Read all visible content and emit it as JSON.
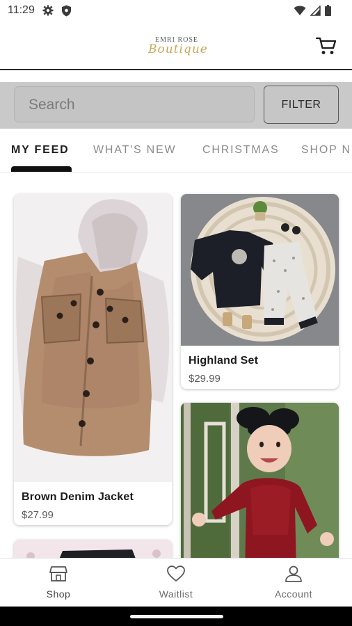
{
  "status_bar": {
    "time": "11:29",
    "icons": [
      "gear-icon",
      "shield-icon",
      "wifi-icon",
      "signal-icon",
      "battery-icon"
    ]
  },
  "header": {
    "logo_top": "EMRI ROSE",
    "logo_bottom": "Boutique",
    "cart_icon": "cart-icon"
  },
  "search": {
    "placeholder": "Search",
    "filter_label": "FILTER"
  },
  "tabs": [
    {
      "label": "MY FEED",
      "active": true
    },
    {
      "label": "WHAT'S NEW",
      "active": false
    },
    {
      "label": "CHRISTMAS",
      "active": false
    },
    {
      "label": "SHOP N",
      "active": false
    }
  ],
  "products": [
    {
      "name": "Brown Denim Jacket",
      "price": "$27.99"
    },
    {
      "name": "Highland Set",
      "price": "$29.99"
    }
  ],
  "bottom_nav": [
    {
      "label": "Shop",
      "icon": "shop-icon",
      "active": true
    },
    {
      "label": "Waitlist",
      "icon": "heart-icon",
      "active": false
    },
    {
      "label": "Account",
      "icon": "account-icon",
      "active": false
    }
  ],
  "colors": {
    "search_band": "#c9c9c9",
    "logo_gold": "#c9a55b",
    "active_tab": "#1e1e1e",
    "inactive_tab": "#8a8a8a"
  }
}
